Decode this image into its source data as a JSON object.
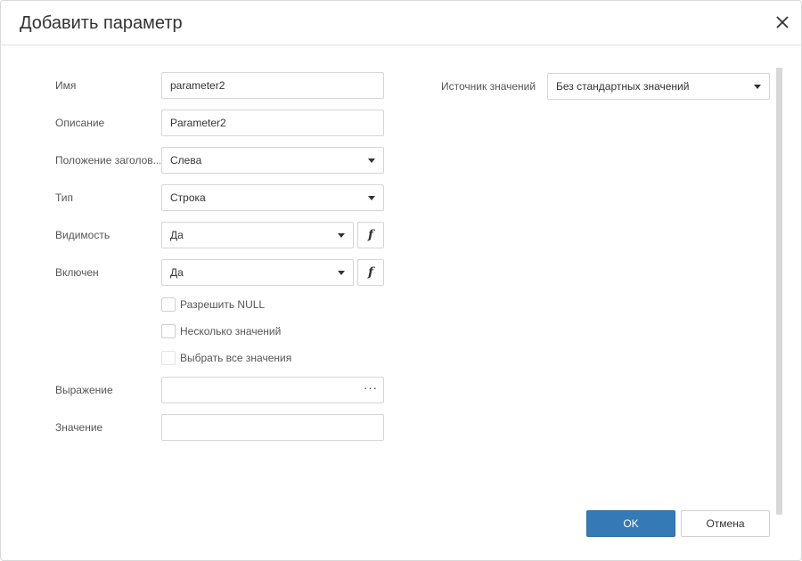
{
  "dialog": {
    "title": "Добавить параметр",
    "close_icon": "close-icon"
  },
  "form": {
    "name": {
      "label": "Имя",
      "value": "parameter2"
    },
    "description": {
      "label": "Описание",
      "value": "Parameter2"
    },
    "title_position": {
      "label": "Положение заголов...",
      "value": "Слева"
    },
    "type": {
      "label": "Тип",
      "value": "Строка"
    },
    "visibility": {
      "label": "Видимость",
      "value": "Да",
      "fx": "f"
    },
    "enabled": {
      "label": "Включен",
      "value": "Да",
      "fx": "f"
    },
    "allow_null": {
      "label": "Разрешить NULL",
      "checked": false
    },
    "multi_value": {
      "label": "Несколько значений",
      "checked": false
    },
    "select_all": {
      "label": "Выбрать все значения",
      "checked": false,
      "disabled": true
    },
    "expression": {
      "label": "Выражение",
      "value": "",
      "button": "···"
    },
    "value": {
      "label": "Значение",
      "value": ""
    }
  },
  "value_source": {
    "label": "Источник значений",
    "value": "Без стандартных значений"
  },
  "buttons": {
    "ok": "OK",
    "cancel": "Отмена"
  },
  "colors": {
    "primary": "#337ab7",
    "border": "#d6d6d6"
  }
}
